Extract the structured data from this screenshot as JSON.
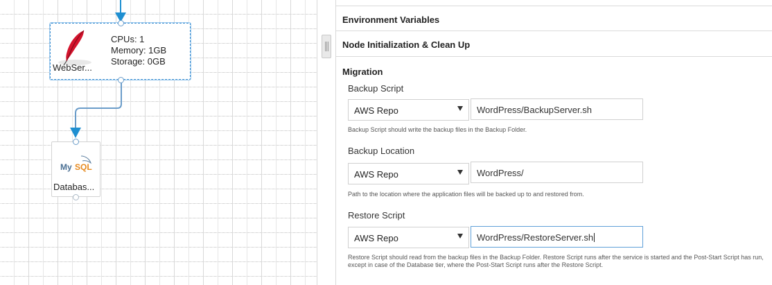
{
  "canvas": {
    "webserver_node": {
      "name": "WebSer...",
      "cpus": "CPUs: 1",
      "memory": "Memory: 1GB",
      "storage": "Storage: 0GB",
      "icon": "feather-icon"
    },
    "database_node": {
      "name": "Databas...",
      "icon": "mysql-logo-icon",
      "logo_text_my": "My",
      "logo_text_sql": "SQL"
    },
    "colors": {
      "wire": "#1f8fd1",
      "port_border": "#6a9cc9",
      "selection": "#3d8fd1"
    }
  },
  "panel": {
    "sections": {
      "env_vars": "Environment Variables",
      "node_init": "Node Initialization & Clean Up",
      "migration": "Migration"
    },
    "backup_script": {
      "label": "Backup Script",
      "repo": "AWS Repo",
      "path": "WordPress/BackupServer.sh",
      "help": "Backup Script should write the backup files in the Backup Folder."
    },
    "backup_location": {
      "label": "Backup Location",
      "repo": "AWS Repo",
      "path": "WordPress/",
      "help": "Path to the location where the application files will be backed up to and restored from."
    },
    "restore_script": {
      "label": "Restore Script",
      "repo": "AWS Repo",
      "path": "WordPress/RestoreServer.sh",
      "help": "Restore Script should read from the backup files in the Backup Folder. Restore Script runs after the service is started and the Post-Start Script has run, except in case of the Database tier, where the Post-Start Script runs after the Restore Script."
    }
  }
}
